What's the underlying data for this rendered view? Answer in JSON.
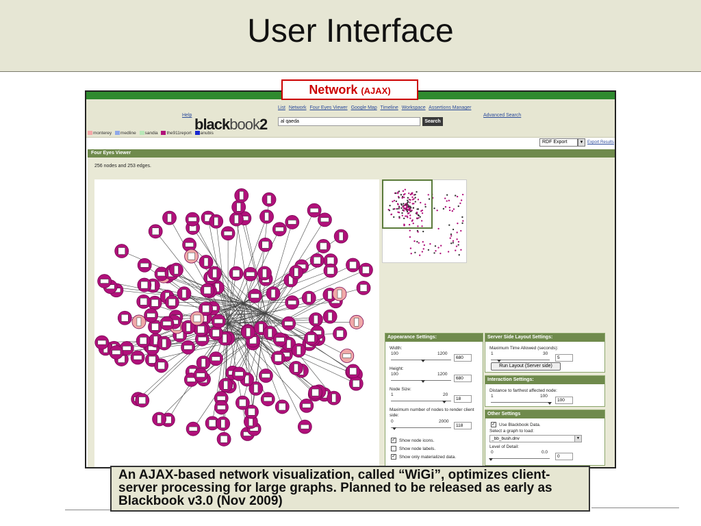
{
  "slide": {
    "title": "User Interface",
    "callout_main": "Network",
    "callout_sub": "(AJAX)",
    "caption": "An AJAX-based network visualization, called “WiGi”, optimizes client-server processing for large graphs. Planned to be released as early as Blackbook v3.0 (Nov 2009)"
  },
  "app": {
    "help": "Help",
    "logo_bold": "black",
    "logo_light": "book",
    "logo_version": "2",
    "nav_links": [
      "List",
      "Network",
      "Four Eyes Viewer",
      "Google Map",
      "Timeline",
      "Workspace",
      "Assertions Manager"
    ],
    "search_value": "al qaeda",
    "search_button": "Search",
    "advanced_search": "Advanced Search",
    "legend": [
      {
        "label": "monterey",
        "color": "#f4a8a8"
      },
      {
        "label": "medline",
        "color": "#8fa8e8"
      },
      {
        "label": "sandia",
        "color": "#b8e8b8"
      },
      {
        "label": "the911report",
        "color": "#b0107a"
      },
      {
        "label": "anubis",
        "color": "#1a2ad0"
      }
    ],
    "export_select": "RDF Export",
    "export_link": "Export Results",
    "viewer_title": "Four Eyes Viewer",
    "stats": "256 nodes and 253 edges."
  },
  "appearance": {
    "title": "Appearance Settings:",
    "width_label": "Width:",
    "width_min": "100",
    "width_max": "1200",
    "width_value": "680",
    "width_level": 0.53,
    "height_label": "Height:",
    "height_min": "100",
    "height_max": "1200",
    "height_value": "680",
    "height_level": 0.53,
    "node_size_label": "Node Size:",
    "node_min": "1",
    "node_max": "20",
    "node_value": "18",
    "node_level": 0.89,
    "max_nodes_label": "Maximum number of nodes to render client side:",
    "max_min": "0",
    "max_max": "2000",
    "max_value": "118",
    "max_level": 0.06,
    "check_icons": "Show node icons.",
    "check_labels": "Show node labels.",
    "check_materialized": "Show only materialized data."
  },
  "server_layout": {
    "title": "Server Side Layout Settings:",
    "max_time_label": "Maximum Time Allowed (seconds):",
    "time_min": "1",
    "time_max": "30",
    "time_value": "5",
    "time_level": 0.14,
    "run_button": "Run Layout (Server side)"
  },
  "interaction": {
    "title": "Interaction Settings:",
    "distance_label": "Distance to farthest affected node:",
    "dist_min": "1",
    "dist_max": "100",
    "dist_value": "100",
    "dist_level": 1.0
  },
  "other": {
    "title": "Other Settings",
    "use_blackbook": "Use Blackbook Data.",
    "select_graph_label": "Select a graph to load:",
    "graph_value": "_bb_bush.dnv",
    "detail_label": "Level of Detail:",
    "detail_min": "0",
    "detail_max": "0.0",
    "detail_value": "0",
    "detail_level": 0.0
  },
  "colors": {
    "node": "#b0107a",
    "node_stroke": "#7a0a55",
    "node_light": "#f0a8a8",
    "panel_header": "#6f8a4c",
    "app_topbar": "#2f8a2f"
  }
}
